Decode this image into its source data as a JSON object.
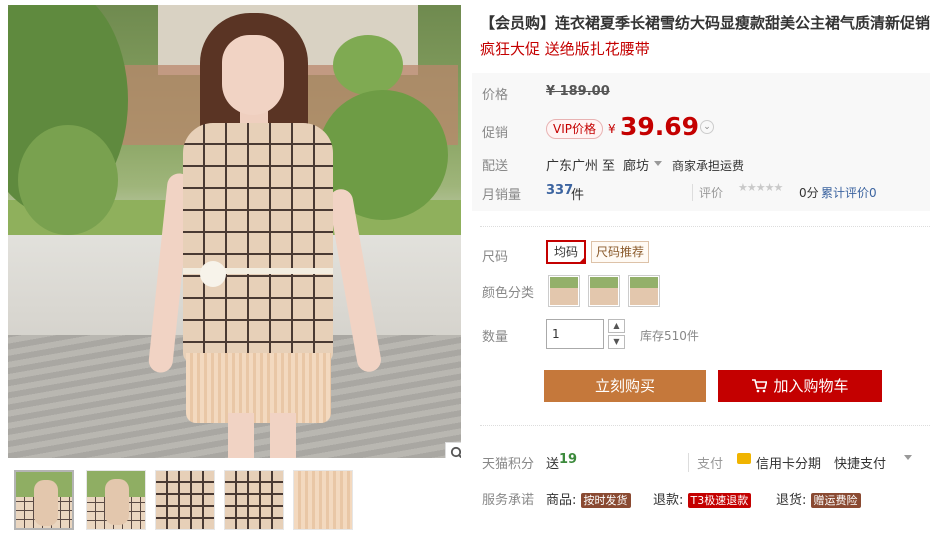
{
  "gallery": {
    "thumbnails": [
      "Front view",
      "Back view",
      "Side view",
      "Belt detail",
      "Skirt detail"
    ]
  },
  "product": {
    "title": "【会员购】连衣裙夏季长裙雪纺大码显瘦款甜美公主裙气质清新促销",
    "subtitle": "疯狂大促 送绝版扎花腰带"
  },
  "price": {
    "label": "价格",
    "original": "¥ 189.00",
    "promo_label": "促销",
    "vip_tag": "VIP价格",
    "currency": "¥",
    "promo_price": "39.69"
  },
  "shipping": {
    "label": "配送",
    "from": "广东广州",
    "to_word": "至",
    "to": "廊坊",
    "note": "商家承担运费"
  },
  "sales": {
    "label": "月销量",
    "count": "337",
    "unit": "件",
    "rating_label": "评价",
    "stars": "★★★★★",
    "score": "0分",
    "total_reviews": "累计评价0"
  },
  "options": {
    "size_label": "尺码",
    "size_selected": "均码",
    "size_recommend": "尺码推荐",
    "color_label": "颜色分类",
    "colors": [
      "Color 1",
      "Color 2",
      "Color 3"
    ],
    "quantity_label": "数量",
    "quantity_value": "1",
    "stock": "库存510件"
  },
  "actions": {
    "buy": "立刻购买",
    "cart": "加入购物车"
  },
  "rewards": {
    "label": "天猫积分",
    "send": "送",
    "points": "19",
    "pay_label": "支付",
    "installment": "信用卡分期",
    "quick_pay": "快捷支付"
  },
  "service": {
    "label": "服务承诺",
    "goods": "商品:",
    "goods_tag": "按时发货",
    "refund": "退款:",
    "refund_tag": "T3极速退款",
    "return": "退货:",
    "return_tag": "赠运费险"
  },
  "colors": {
    "accent": "#c40000",
    "buy_button": "#c5783b",
    "link_blue": "#3c64a0"
  }
}
